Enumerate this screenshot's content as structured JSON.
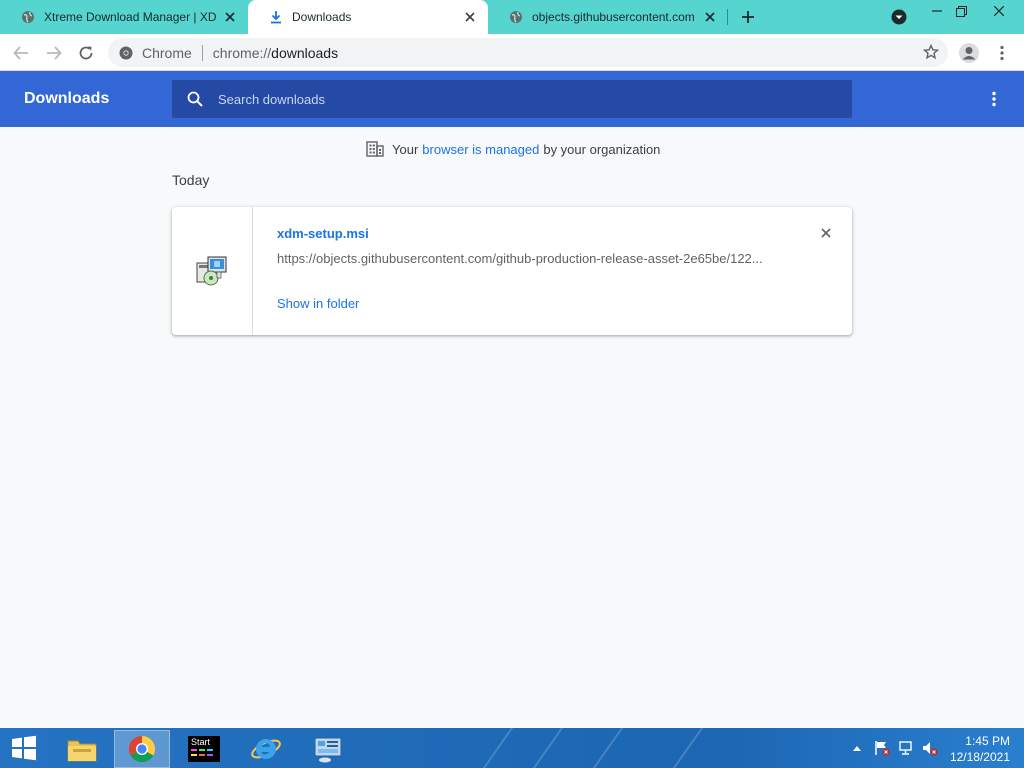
{
  "tabs": [
    {
      "title": "Xtreme Download Manager | XDM",
      "active": false,
      "icon": "globe-icon"
    },
    {
      "title": "Downloads",
      "active": true,
      "icon": "download-icon"
    },
    {
      "title": "objects.githubusercontent.com",
      "active": false,
      "icon": "globe-icon"
    }
  ],
  "omnibox": {
    "chip": "Chrome",
    "url_scheme": "chrome://",
    "url_host": "downloads"
  },
  "downloads_page": {
    "title": "Downloads",
    "search_placeholder": "Search downloads",
    "managed": {
      "prefix": "Your",
      "link": "browser is managed",
      "suffix": "by your organization"
    },
    "section_label": "Today",
    "items": [
      {
        "file_name": "xdm-setup.msi",
        "url": "https://objects.githubusercontent.com/github-production-release-asset-2e65be/122...",
        "action": "Show in folder"
      }
    ]
  },
  "taskbar": {
    "apps": [
      "file-explorer-icon",
      "chrome-icon",
      "start-app-icon",
      "internet-explorer-icon",
      "control-panel-icon"
    ],
    "start_app_label": "Start",
    "clock_time": "1:45 PM",
    "clock_date": "12/18/2021"
  },
  "colors": {
    "tabstrip": "#55d4d0",
    "header": "#3367d6",
    "search_box": "#254aa5",
    "link": "#1a73e8"
  }
}
